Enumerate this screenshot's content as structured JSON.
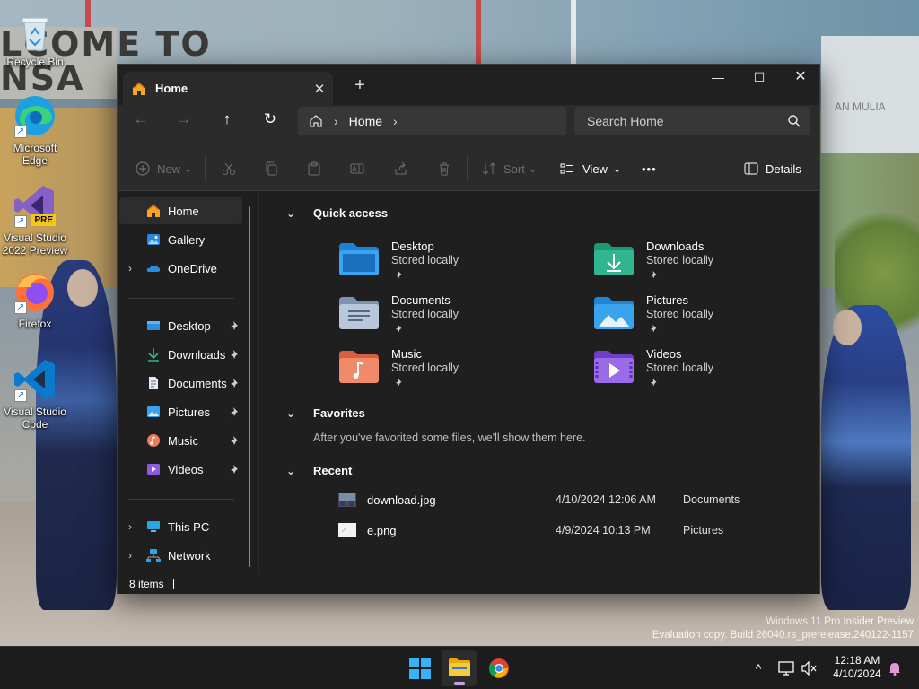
{
  "desktop": {
    "icons": [
      {
        "label": "Recycle Bin",
        "icon": "recycle-bin-icon"
      },
      {
        "label": "Microsoft Edge",
        "icon": "edge-icon"
      },
      {
        "label": "Visual Studio 2022 Preview",
        "icon": "visual-studio-icon",
        "badge": "PRE"
      },
      {
        "label": "Firefox",
        "icon": "firefox-icon"
      },
      {
        "label": "Visual Studio Code",
        "icon": "vscode-icon"
      }
    ],
    "wallpaper_sign_text": "LCOME TO\nNSA",
    "wallpaper_right_sign_text": "AN MULIA",
    "watermark": {
      "line1": "Windows 11 Pro Insider Preview",
      "line2": "Evaluation copy. Build 26040.rs_prerelease.240122-1157"
    }
  },
  "explorer": {
    "tab_title": "Home",
    "tab_close_glyph": "✕",
    "new_tab_glyph": "+",
    "window_controls": {
      "minimize": "—",
      "maximize": "☐",
      "close": "✕"
    },
    "nav": {
      "back": "←",
      "forward": "→",
      "up": "↑",
      "refresh": "↻"
    },
    "breadcrumb": {
      "separator": "›",
      "crumb": "Home",
      "trailing": "›"
    },
    "search_placeholder": "Search Home",
    "toolbar": {
      "new_label": "New",
      "sort_label": "Sort",
      "view_label": "View",
      "more_label": "•••",
      "details_label": "Details",
      "dropdown_glyph": "⌄"
    },
    "sidebar": {
      "home": "Home",
      "gallery": "Gallery",
      "onedrive": "OneDrive",
      "pinned": [
        "Desktop",
        "Downloads",
        "Documents",
        "Pictures",
        "Music",
        "Videos"
      ],
      "this_pc": "This PC",
      "network": "Network",
      "expand_glyph": "›"
    },
    "content": {
      "quick_access_title": "Quick access",
      "section_chevron": "⌄",
      "quick_access": [
        {
          "name": "Desktop",
          "sub": "Stored locally",
          "color": "#2d8fe0"
        },
        {
          "name": "Downloads",
          "sub": "Stored locally",
          "color": "#2fb58f"
        },
        {
          "name": "Documents",
          "sub": "Stored locally",
          "color": "#9fb2c8"
        },
        {
          "name": "Pictures",
          "sub": "Stored locally",
          "color": "#39a3ee"
        },
        {
          "name": "Music",
          "sub": "Stored locally",
          "color": "#ef7c5c"
        },
        {
          "name": "Videos",
          "sub": "Stored locally",
          "color": "#8c5ce0"
        }
      ],
      "favorites_title": "Favorites",
      "favorites_note": "After you've favorited some files, we'll show them here.",
      "recent_title": "Recent",
      "recent": [
        {
          "name": "download.jpg",
          "date": "4/10/2024 12:06 AM",
          "location": "Documents"
        },
        {
          "name": "e.png",
          "date": "4/9/2024 10:13 PM",
          "location": "Pictures"
        }
      ]
    },
    "status": "8 items"
  },
  "taskbar": {
    "apps": [
      "start-icon",
      "file-explorer-icon",
      "chrome-icon"
    ],
    "tray_chevron": "^",
    "time": "12:18 AM",
    "date": "4/10/2024",
    "accent": "#c7a1dd"
  }
}
